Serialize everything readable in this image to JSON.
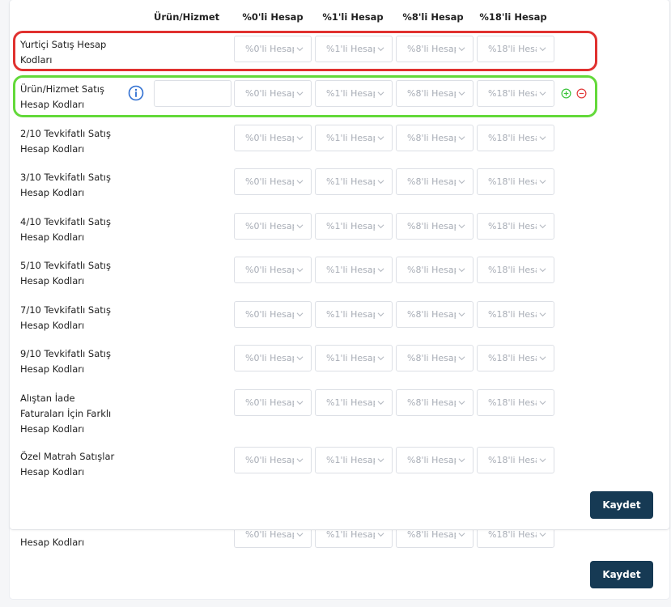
{
  "header": {
    "urun": "Ürün/Hizmet",
    "col0": "%0'li Hesap",
    "col1": "%1'li Hesap",
    "col8": "%8'li Hesap",
    "col18": "%18'li Hesap"
  },
  "placeholders": {
    "p0": "%0'li Hesap",
    "p1": "%1'li Hesap",
    "p8": "%8'li Hesap",
    "p18": "%18'li Hesap"
  },
  "rows": [
    {
      "label_lines": [
        "Yurtiçi Satış Hesap",
        "Kodları"
      ]
    },
    {
      "label_lines": [
        "Ürün/Hizmet Satış",
        "Hesap Kodları"
      ]
    },
    {
      "label_lines": [
        "2/10 Tevkifatlı Satış",
        "Hesap Kodları"
      ]
    },
    {
      "label_lines": [
        "3/10 Tevkifatlı Satış",
        "Hesap Kodları"
      ]
    },
    {
      "label_lines": [
        "4/10 Tevkifatlı Satış",
        "Hesap Kodları"
      ]
    },
    {
      "label_lines": [
        "5/10 Tevkifatlı Satış",
        "Hesap Kodları"
      ]
    },
    {
      "label_lines": [
        "7/10 Tevkifatlı Satış",
        "Hesap Kodları"
      ]
    },
    {
      "label_lines": [
        "9/10 Tevkifatlı Satış",
        "Hesap Kodları"
      ]
    },
    {
      "label_lines": [
        "Alıştan İade",
        "Faturaları İçin Farklı",
        "Hesap Kodları"
      ]
    },
    {
      "label_lines": [
        "Özel Matrah Satışlar",
        "Hesap Kodları"
      ]
    }
  ],
  "back_card": {
    "label": "Hesap Kodları",
    "save_label": "Kaydet"
  },
  "save_label": "Kaydet",
  "colors": {
    "primary": "#163a54",
    "highlight_red": "#e0312f",
    "highlight_green": "#63d93a",
    "info_blue": "#2f6fd1",
    "plus_green": "#3cc43c",
    "minus_red": "#e23a3a"
  }
}
